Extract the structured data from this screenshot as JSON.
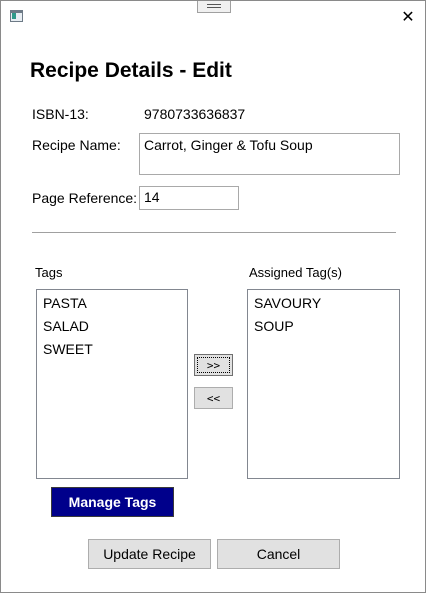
{
  "window": {
    "close_glyph": "✕"
  },
  "header": {
    "title": "Recipe Details - Edit"
  },
  "form": {
    "isbn_label": "ISBN-13:",
    "isbn_value": "9780733636837",
    "name_label": "Recipe Name:",
    "name_value": "Carrot, Ginger & Tofu Soup",
    "page_label": "Page Reference:",
    "page_value": "14"
  },
  "tags": {
    "available_label": "Tags",
    "assigned_label": "Assigned Tag(s)",
    "available": [
      "PASTA",
      "SALAD",
      "SWEET"
    ],
    "assigned": [
      "SAVOURY",
      "SOUP"
    ],
    "add_label": ">>",
    "remove_label": "<<",
    "manage_label": "Manage Tags"
  },
  "actions": {
    "update_label": "Update Recipe",
    "cancel_label": "Cancel"
  },
  "colors": {
    "manage_button_bg": "#00008b",
    "button_bg": "#e1e1e1"
  }
}
